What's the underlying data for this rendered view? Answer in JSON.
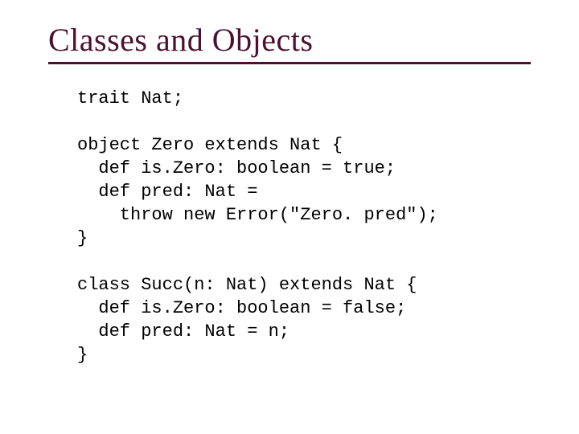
{
  "title": "Classes and Objects",
  "code": {
    "l1": "trait Nat;",
    "l2": "",
    "l3": "object Zero extends Nat {",
    "l4": "  def is.Zero: boolean = true;",
    "l5": "  def pred: Nat =",
    "l6": "    throw new Error(\"Zero. pred\");",
    "l7": "}",
    "l8": "",
    "l9": "class Succ(n: Nat) extends Nat {",
    "l10": "  def is.Zero: boolean = false;",
    "l11": "  def pred: Nat = n;",
    "l12": "}"
  }
}
